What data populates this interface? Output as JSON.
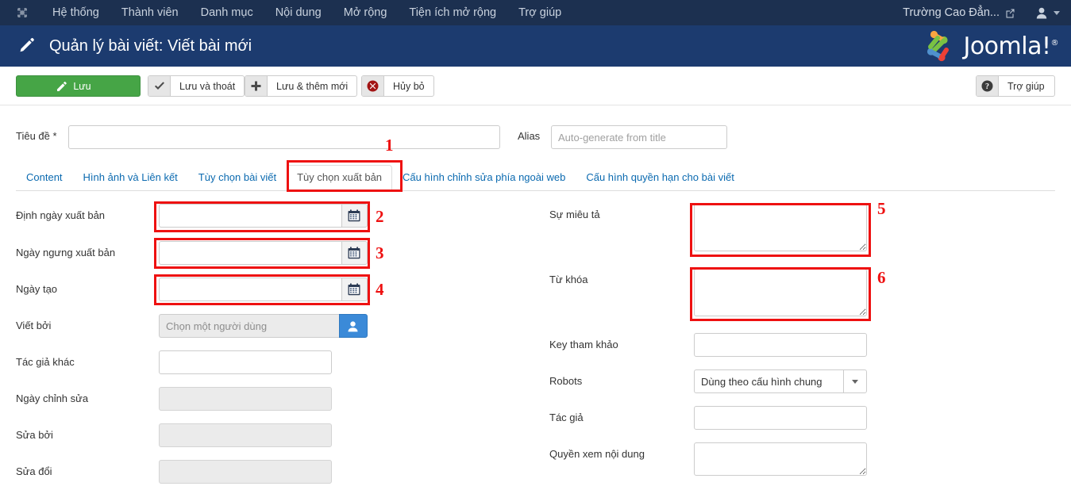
{
  "topbar": {
    "brand_icon": "joomla-logo-icon",
    "menu": [
      {
        "label": "Hệ thống"
      },
      {
        "label": "Thành viên"
      },
      {
        "label": "Danh mục"
      },
      {
        "label": "Nội dung"
      },
      {
        "label": "Mở rộng"
      },
      {
        "label": "Tiện ích mở rộng"
      },
      {
        "label": "Trợ giúp"
      }
    ],
    "site_name": "Trường Cao Đẳn...",
    "external_link_icon": "external-link-icon",
    "user_icon": "user-icon",
    "caret_icon": "chevron-down-icon"
  },
  "header": {
    "icon": "pencil-icon",
    "title": "Quản lý bài viết: Viết bài mới",
    "logo_text": "Joomla!",
    "logo_reg": "®",
    "bg_color": "#1c3b6f"
  },
  "toolbar": {
    "save": {
      "label": "Lưu",
      "icon": "save-pencil-icon",
      "color": "#46a546"
    },
    "save_close": {
      "label": "Lưu và thoát",
      "icon": "check-icon"
    },
    "save_new": {
      "label": "Lưu & thêm mới",
      "icon": "plus-icon"
    },
    "cancel": {
      "label": "Hủy bỏ",
      "icon": "cancel-circle-icon"
    },
    "help": {
      "label": "Trợ giúp",
      "icon": "question-circle-icon"
    }
  },
  "title_row": {
    "title_label": "Tiêu đề *",
    "title_value": "",
    "title_placeholder": "",
    "alias_label": "Alias",
    "alias_value": "",
    "alias_placeholder": "Auto-generate from title"
  },
  "tabs": [
    {
      "label": "Content",
      "active": false
    },
    {
      "label": "Hình ảnh và Liên kết",
      "active": false
    },
    {
      "label": "Tùy chọn bài viết",
      "active": false
    },
    {
      "label": "Tùy chọn xuất bản",
      "active": true
    },
    {
      "label": "Cấu hình chỉnh sửa phía ngoài web",
      "active": false
    },
    {
      "label": "Cấu hình quyền hạn cho bài viết",
      "active": false
    }
  ],
  "left_fields": [
    {
      "label": "Định ngày xuất bản",
      "type": "calendar",
      "value": "",
      "icon": "calendar-icon"
    },
    {
      "label": "Ngày ngưng xuất bản",
      "type": "calendar",
      "value": "",
      "icon": "calendar-icon"
    },
    {
      "label": "Ngày tạo",
      "type": "calendar",
      "value": "",
      "icon": "calendar-icon"
    },
    {
      "label": "Viết bởi",
      "type": "userpicker",
      "value": "",
      "placeholder": "Chọn một người dùng",
      "icon": "user-select-icon"
    },
    {
      "label": "Tác giả khác",
      "type": "text",
      "value": ""
    },
    {
      "label": "Ngày chỉnh sửa",
      "type": "text-disabled",
      "value": ""
    },
    {
      "label": "Sửa bởi",
      "type": "text-disabled",
      "value": ""
    },
    {
      "label": "Sửa đổi",
      "type": "text-disabled",
      "value": ""
    }
  ],
  "right_fields": [
    {
      "label": "Sự miêu tả",
      "type": "textarea",
      "value": ""
    },
    {
      "label": "Từ khóa",
      "type": "textarea",
      "value": ""
    },
    {
      "label": "Key tham khảo",
      "type": "text",
      "value": ""
    },
    {
      "label": "Robots",
      "type": "select",
      "value": "Dùng theo cấu hình chung",
      "icon": "chevron-down-icon"
    },
    {
      "label": "Tác giả",
      "type": "text",
      "value": ""
    },
    {
      "label": "Quyền xem nội dung",
      "type": "textarea",
      "value": ""
    }
  ],
  "annotations": {
    "color": "#ee1111",
    "markers": [
      {
        "number": "1",
        "target": "tab-tuy-chon-xuat-ban"
      },
      {
        "number": "2",
        "target": "field-dinh-ngay-xuat-ban"
      },
      {
        "number": "3",
        "target": "field-ngay-ngung-xuat-ban"
      },
      {
        "number": "4",
        "target": "field-ngay-tao"
      },
      {
        "number": "5",
        "target": "field-su-mieu-ta"
      },
      {
        "number": "6",
        "target": "field-tu-khoa"
      }
    ]
  }
}
